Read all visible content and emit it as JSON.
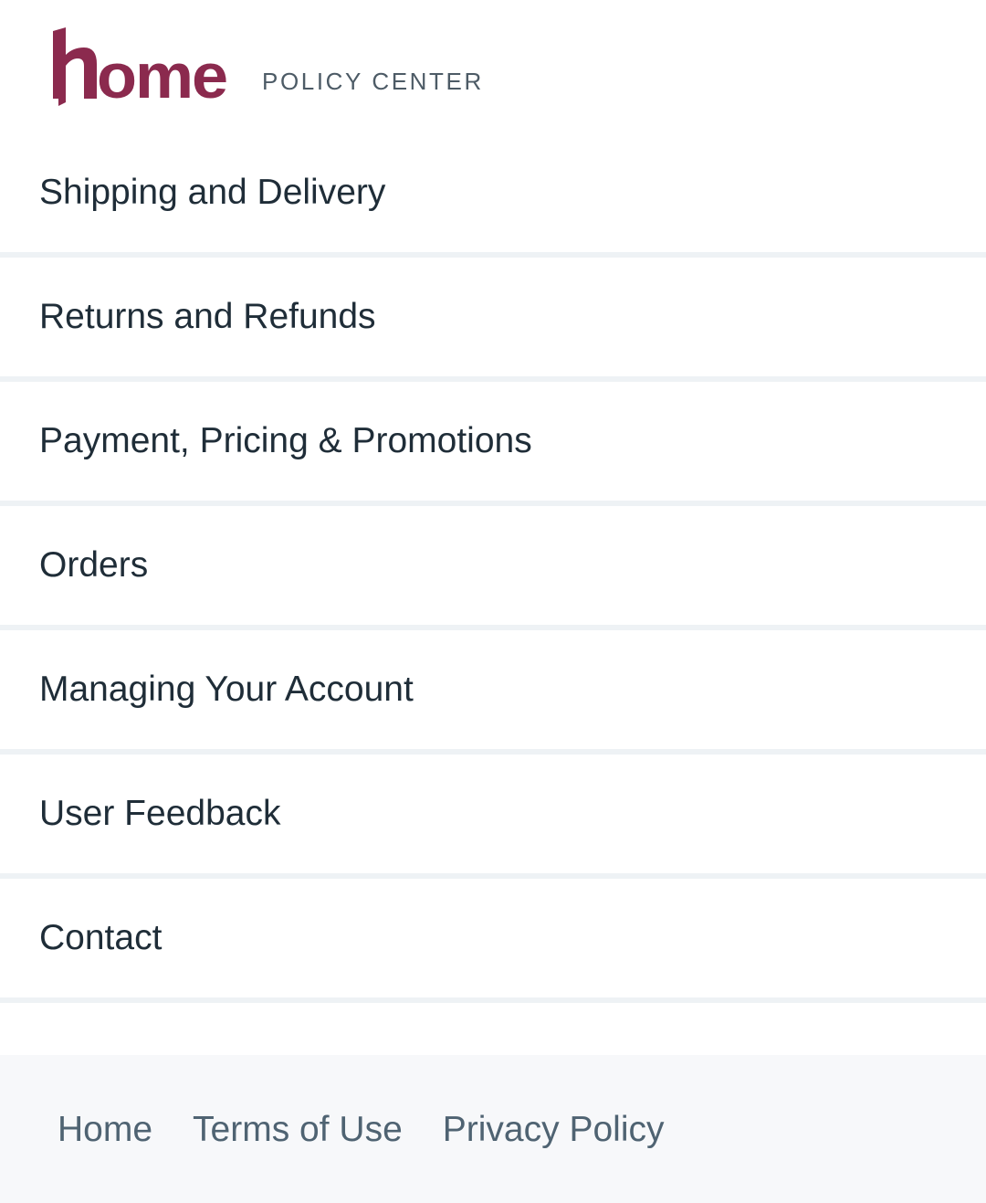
{
  "header": {
    "logo_text": "home",
    "subtitle": "POLICY CENTER",
    "brand_color": "#8b2a4e"
  },
  "menu": {
    "items": [
      {
        "label": "Shipping and Delivery"
      },
      {
        "label": "Returns and Refunds"
      },
      {
        "label": "Payment, Pricing & Promotions"
      },
      {
        "label": "Orders"
      },
      {
        "label": "Managing Your Account"
      },
      {
        "label": "User Feedback"
      },
      {
        "label": "Contact"
      }
    ]
  },
  "footer": {
    "links": [
      {
        "label": "Home"
      },
      {
        "label": "Terms of Use"
      },
      {
        "label": "Privacy Policy"
      }
    ]
  }
}
